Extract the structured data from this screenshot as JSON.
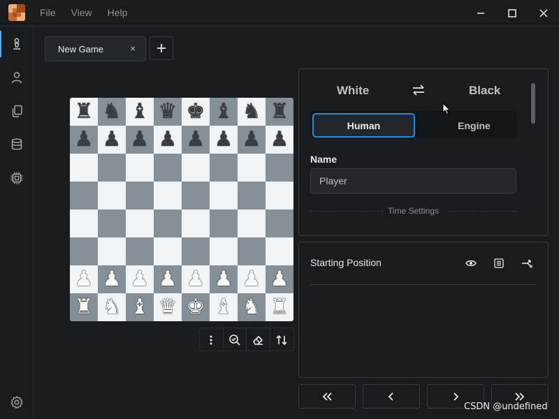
{
  "menu": {
    "file": "File",
    "view": "View",
    "help": "Help"
  },
  "tabs": [
    {
      "label": "New Game",
      "close": "×"
    }
  ],
  "board": {
    "rows": [
      [
        [
          "♜",
          "b"
        ],
        [
          "♞",
          "b"
        ],
        [
          "♝",
          "b"
        ],
        [
          "♛",
          "b"
        ],
        [
          "♚",
          "b"
        ],
        [
          "♝",
          "b"
        ],
        [
          "♞",
          "b"
        ],
        [
          "♜",
          "b"
        ]
      ],
      [
        [
          "♟",
          "b"
        ],
        [
          "♟",
          "b"
        ],
        [
          "♟",
          "b"
        ],
        [
          "♟",
          "b"
        ],
        [
          "♟",
          "b"
        ],
        [
          "♟",
          "b"
        ],
        [
          "♟",
          "b"
        ],
        [
          "♟",
          "b"
        ]
      ],
      [
        [
          "",
          ""
        ],
        [
          "",
          ""
        ],
        [
          "",
          ""
        ],
        [
          "",
          ""
        ],
        [
          "",
          ""
        ],
        [
          "",
          ""
        ],
        [
          "",
          ""
        ],
        [
          "",
          ""
        ]
      ],
      [
        [
          "",
          ""
        ],
        [
          "",
          ""
        ],
        [
          "",
          ""
        ],
        [
          "",
          ""
        ],
        [
          "",
          ""
        ],
        [
          "",
          ""
        ],
        [
          "",
          ""
        ],
        [
          "",
          ""
        ]
      ],
      [
        [
          "",
          ""
        ],
        [
          "",
          ""
        ],
        [
          "",
          ""
        ],
        [
          "",
          ""
        ],
        [
          "",
          ""
        ],
        [
          "",
          ""
        ],
        [
          "",
          ""
        ],
        [
          "",
          ""
        ]
      ],
      [
        [
          "",
          ""
        ],
        [
          "",
          ""
        ],
        [
          "",
          ""
        ],
        [
          "",
          ""
        ],
        [
          "",
          ""
        ],
        [
          "",
          ""
        ],
        [
          "",
          ""
        ],
        [
          "",
          ""
        ]
      ],
      [
        [
          "♟",
          "w"
        ],
        [
          "♟",
          "w"
        ],
        [
          "♟",
          "w"
        ],
        [
          "♟",
          "w"
        ],
        [
          "♟",
          "w"
        ],
        [
          "♟",
          "w"
        ],
        [
          "♟",
          "w"
        ],
        [
          "♟",
          "w"
        ]
      ],
      [
        [
          "♜",
          "w"
        ],
        [
          "♞",
          "w"
        ],
        [
          "♝",
          "w"
        ],
        [
          "♛",
          "w"
        ],
        [
          "♚",
          "w"
        ],
        [
          "♝",
          "w"
        ],
        [
          "♞",
          "w"
        ],
        [
          "♜",
          "w"
        ]
      ]
    ]
  },
  "players": {
    "white": "White",
    "black": "Black",
    "mode_human": "Human",
    "mode_engine": "Engine",
    "name_label": "Name",
    "name_value": "Player",
    "time_settings": "Time Settings"
  },
  "analysis": {
    "title": "Starting Position"
  },
  "watermark": "CSDN @undefined",
  "colors": {
    "accent": "#228be6",
    "background": "#1a1b1e",
    "light_square": "#f1f3f5",
    "dark_square": "#868e96"
  }
}
